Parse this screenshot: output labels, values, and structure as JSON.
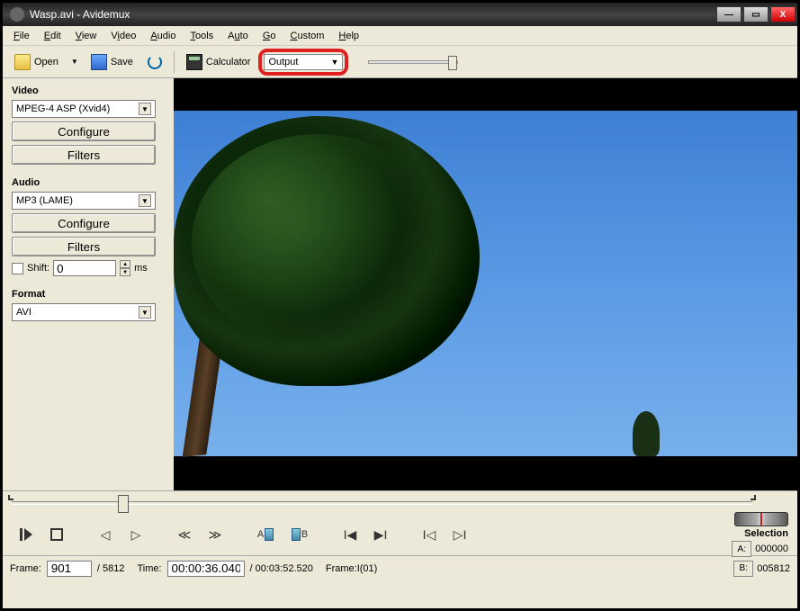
{
  "window": {
    "title": "Wasp.avi - Avidemux"
  },
  "menu": {
    "items": [
      "File",
      "Edit",
      "View",
      "Video",
      "Audio",
      "Tools",
      "Auto",
      "Go",
      "Custom",
      "Help"
    ]
  },
  "toolbar": {
    "open": "Open",
    "save": "Save",
    "calculator": "Calculator",
    "output": "Output"
  },
  "sidepanel": {
    "video": {
      "label": "Video",
      "codec": "MPEG-4 ASP (Xvid4)",
      "configure": "Configure",
      "filters": "Filters"
    },
    "audio": {
      "label": "Audio",
      "codec": "MP3 (LAME)",
      "configure": "Configure",
      "filters": "Filters",
      "shift_label": "Shift:",
      "shift_value": "0",
      "shift_unit": "ms"
    },
    "format": {
      "label": "Format",
      "container": "AVI"
    }
  },
  "controls": {
    "markA": "A",
    "markB": "B"
  },
  "selection": {
    "label": "Selection",
    "a_label": "A:",
    "a_value": "000000",
    "b_label": "B:",
    "b_value": "005812"
  },
  "status": {
    "frame_label": "Frame:",
    "frame_value": "901",
    "frame_total": "/ 5812",
    "time_label": "Time:",
    "time_value": "00:00:36.040",
    "time_total": "/ 00:03:52.520",
    "frame_type": "Frame:I(01)"
  }
}
